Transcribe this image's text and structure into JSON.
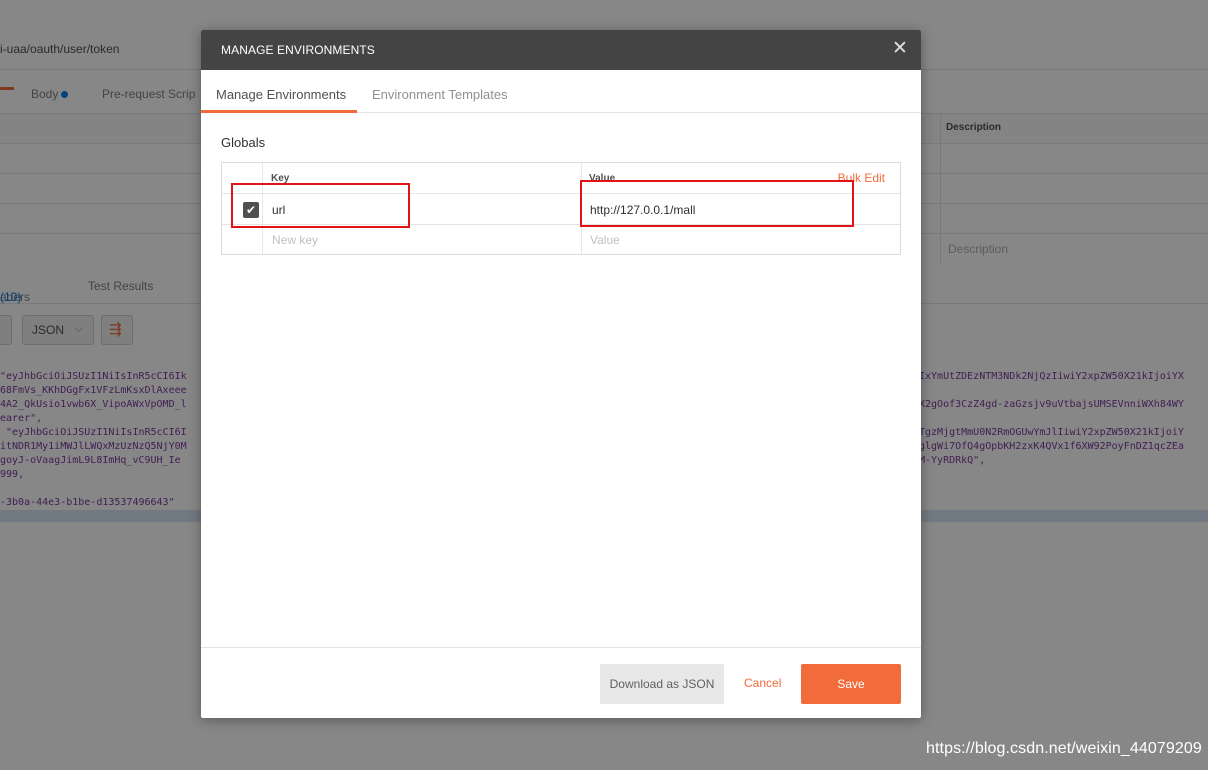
{
  "background": {
    "url_text": "i-uaa/oauth/user/token",
    "tabs": {
      "body": "Body",
      "prerequest": "Pre-request Scrip"
    },
    "table_header_description": "Description",
    "description_placeholder": "Description",
    "response_tabs": {
      "headers": "aders",
      "headers_count": "(10)",
      "test_results": "Test Results"
    },
    "format_select": "JSON",
    "code_left": [
      "\"eyJhbGciOiJSUzI1NiIsInR5cCI6Ik",
      "68FmVs_KKhDGgFx1VFzLmKsxDlAxeee",
      "4A2_QkUsio1vwb6X_VipoAWxVpOMD_l",
      "earer\",",
      " \"eyJhbGciOiJSUzI1NiIsInR5cCI6I",
      "itNDR1My1iMWJlLWQxMzUzNzQ5NjY0M",
      "goyJ-oVaagJimL9L8ImHq_vC9UH_Ie",
      "999,",
      "",
      "-3b0a-44e3-b1be-d13537496643\""
    ],
    "code_right": [
      "IxYmUtZDEzNTM3NDk2NjQzIiwiY2xpZW50X21kIjoiYX",
      "",
      "X2gOof3CzZ4gd-zaGzsjv9uVtbajsUMSEVnniWXh84WY",
      "",
      "TgzMjgtMmU0N2RmOGUwYmJlIiwiY2xpZW50X21kIjoiY",
      "glgWi7OfQ4gOpbKH2zxK4QVx1f6XW92PoyFnDZ1qcZEa",
      "M-YyRDRkQ\","
    ]
  },
  "modal": {
    "title": "MANAGE ENVIRONMENTS",
    "close_glyph": "✕",
    "tabs": [
      "Manage Environments",
      "Environment Templates"
    ],
    "section_title": "Globals",
    "table": {
      "key_header": "Key",
      "value_header": "Value",
      "bulk_edit": "Bulk Edit",
      "rows": [
        {
          "checked": true,
          "key": "url",
          "value": "http://127.0.0.1/mall"
        }
      ],
      "key_placeholder": "New key",
      "value_placeholder": "Value"
    },
    "buttons": {
      "download": "Download as JSON",
      "cancel": "Cancel",
      "save": "Save"
    }
  },
  "watermark": "https://blog.csdn.net/weixin_44079209",
  "colors": {
    "accent": "#f26b3a",
    "header_bg": "#444444",
    "annotation_red": "#e01414",
    "link_blue": "#097bed"
  }
}
